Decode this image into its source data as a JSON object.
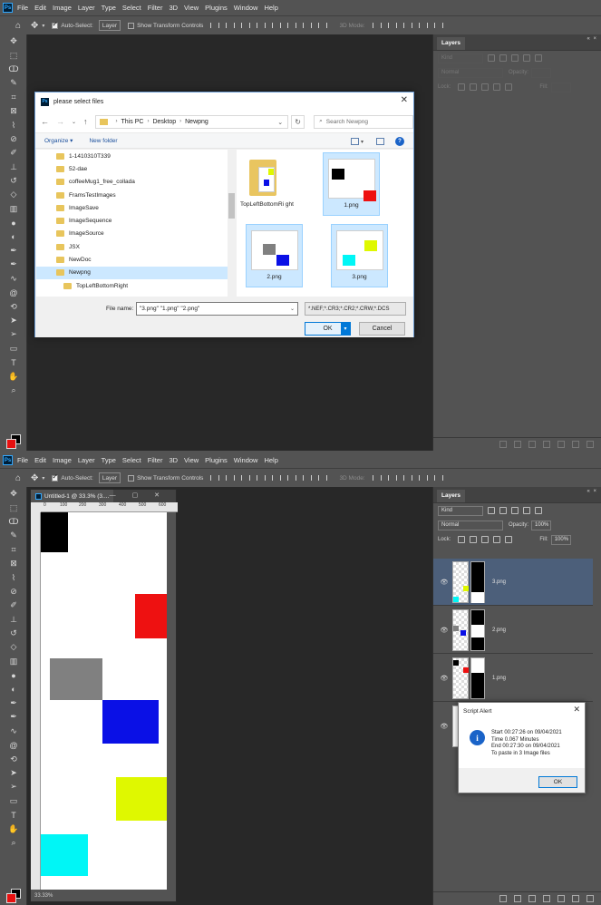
{
  "app": {
    "logo": "Ps",
    "menu": [
      "File",
      "Edit",
      "Image",
      "Layer",
      "Type",
      "Select",
      "Filter",
      "3D",
      "View",
      "Plugins",
      "Window",
      "Help"
    ]
  },
  "options_bar": {
    "auto_select_label": "Auto-Select:",
    "auto_select_target": "Layer",
    "show_transform_label": "Show Transform Controls",
    "mode_3d_label": "3D Mode:"
  },
  "screen_a": {
    "layers_panel": {
      "tab": "Layers",
      "kind_label": "Kind",
      "blend_mode": "Normal",
      "opacity_label": "Opacity:",
      "lock_label": "Lock:",
      "fill_label": "Fill:"
    },
    "dialog": {
      "title": "please select files",
      "breadcrumb": [
        "This PC",
        "Desktop",
        "Newpng"
      ],
      "search_placeholder": "Search Newpng",
      "organize_label": "Organize ▾",
      "new_folder_label": "New folder",
      "tree_items": [
        {
          "label": "1-1410310T339",
          "selected": false,
          "sub": false
        },
        {
          "label": "52-dae",
          "selected": false,
          "sub": false
        },
        {
          "label": "coffeeMug1_free_collada",
          "selected": false,
          "sub": false
        },
        {
          "label": "FramsTestImages",
          "selected": false,
          "sub": false
        },
        {
          "label": "ImageSave",
          "selected": false,
          "sub": false
        },
        {
          "label": "ImageSequence",
          "selected": false,
          "sub": false
        },
        {
          "label": "ImageSource",
          "selected": false,
          "sub": false
        },
        {
          "label": "JSX",
          "selected": false,
          "sub": false
        },
        {
          "label": "NewDoc",
          "selected": false,
          "sub": false
        },
        {
          "label": "Newpng",
          "selected": true,
          "sub": false
        },
        {
          "label": "TopLeftBottomRight",
          "selected": false,
          "sub": true
        }
      ],
      "files": [
        {
          "label": "TopLeftBottomRi ght",
          "kind": "folder",
          "selected": false
        },
        {
          "label": "1.png",
          "kind": "image",
          "selected": true
        },
        {
          "label": "2.png",
          "kind": "image",
          "selected": true
        },
        {
          "label": "3.png",
          "kind": "image",
          "selected": true
        }
      ],
      "file_name_label": "File name:",
      "file_name_value": "\"3.png\" \"1.png\" \"2.png\"",
      "filter_value": "*.NEF;*.CR3;*.CR2;*.CRW;*.DCS",
      "ok_label": "OK",
      "cancel_label": "Cancel"
    }
  },
  "screen_b": {
    "document": {
      "tab_title": "Untitled-1 @ 33.3% (3....",
      "ruler_ticks": [
        "0",
        "100",
        "200",
        "300",
        "400",
        "500",
        "600"
      ],
      "zoom_status": "33.33%",
      "colors": {
        "black": "#000000",
        "red": "#ee1111",
        "gray": "#808080",
        "blue": "#0a10e6",
        "yellow": "#dff800",
        "cyan": "#00f6f6"
      }
    },
    "layers_panel": {
      "tab": "Layers",
      "kind_label": "Kind",
      "blend_mode": "Normal",
      "opacity_label": "Opacity:",
      "opacity_value": "100%",
      "lock_label": "Lock:",
      "fill_label": "Fill:",
      "fill_value": "100%",
      "layers": [
        {
          "name": "3.png",
          "selected": true
        },
        {
          "name": "2.png",
          "selected": false
        },
        {
          "name": "1.png",
          "selected": false
        }
      ]
    },
    "alert": {
      "title": "Script Alert",
      "lines": [
        "Start 00:27:26 on 09/04/2021",
        "Time  0.067 Minutes",
        "End   00:27:30 on 09/04/2021",
        "To paste in 3 Image files"
      ],
      "ok_label": "OK"
    }
  }
}
